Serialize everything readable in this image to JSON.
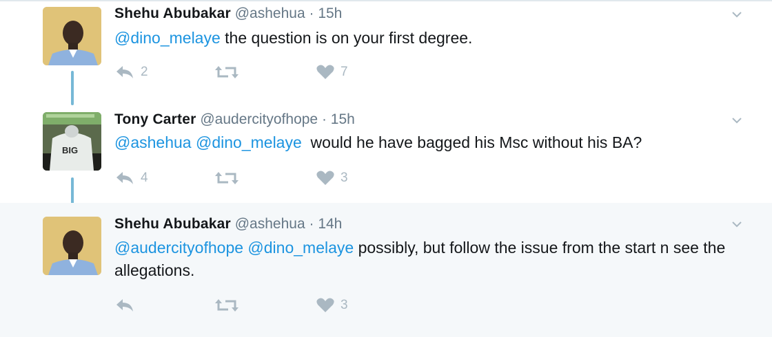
{
  "tweets": [
    {
      "name": "Shehu Abubakar",
      "handle": "@ashehua",
      "separator": "·",
      "time": "15h",
      "mentions": [
        "@dino_melaye"
      ],
      "text": " the question is on your first degree.",
      "actions": {
        "reply_count": "2",
        "retweet_count": "",
        "like_count": "7"
      },
      "avatar": "person-avatar"
    },
    {
      "name": "Tony Carter",
      "handle": "@audercityofhope",
      "separator": "·",
      "time": "15h",
      "mentions": [
        "@ashehua",
        "@dino_melaye"
      ],
      "text": "  would he have bagged his Msc without his BA?",
      "actions": {
        "reply_count": "4",
        "retweet_count": "",
        "like_count": "3"
      },
      "avatar": "shirt-avatar",
      "avatar_text": "BIG"
    },
    {
      "name": "Shehu Abubakar",
      "handle": "@ashehua",
      "separator": "·",
      "time": "14h",
      "mentions": [
        "@audercityofhope",
        "@dino_melaye"
      ],
      "text": " possibly, but follow the issue from the start n see the allegations.",
      "actions": {
        "reply_count": "",
        "retweet_count": "",
        "like_count": "3"
      },
      "avatar": "person-avatar"
    }
  ],
  "colors": {
    "link": "#1c94e0",
    "icon": "#aab8c2",
    "thread": "#76b8d6",
    "highlight_bg": "#f5f8fa"
  }
}
